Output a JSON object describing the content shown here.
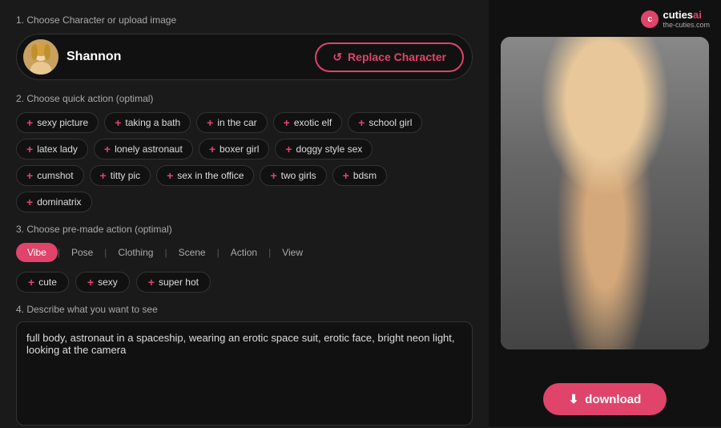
{
  "steps": {
    "step1": "1. Choose Character or upload image",
    "step2": "2. Choose quick action (optimal)",
    "step3": "3. Choose pre-made action (optimal)",
    "step4": "4. Describe what you want to see"
  },
  "character": {
    "name": "Shannon",
    "replace_label": "Replace Character"
  },
  "quick_actions": {
    "row1": [
      {
        "label": "sexy picture"
      },
      {
        "label": "taking a bath"
      },
      {
        "label": "in the car"
      },
      {
        "label": "exotic elf"
      },
      {
        "label": "school girl"
      }
    ],
    "row2": [
      {
        "label": "latex lady"
      },
      {
        "label": "lonely astronaut"
      },
      {
        "label": "boxer girl"
      },
      {
        "label": "doggy style sex"
      }
    ],
    "row3": [
      {
        "label": "cumshot"
      },
      {
        "label": "titty pic"
      },
      {
        "label": "sex in the office"
      },
      {
        "label": "two girls"
      },
      {
        "label": "bdsm"
      }
    ],
    "row4": [
      {
        "label": "dominatrix"
      }
    ]
  },
  "premade_tabs": [
    {
      "label": "Vibe",
      "active": true
    },
    {
      "label": "Pose",
      "active": false
    },
    {
      "label": "Clothing",
      "active": false
    },
    {
      "label": "Scene",
      "active": false
    },
    {
      "label": "Action",
      "active": false
    },
    {
      "label": "View",
      "active": false
    }
  ],
  "vibe_chips": [
    {
      "label": "cute"
    },
    {
      "label": "sexy"
    },
    {
      "label": "super hot"
    }
  ],
  "describe": {
    "placeholder": "Describe what you want to see",
    "value": "full body, astronaut in a spaceship, wearing an erotic space suit, erotic face, bright neon light, looking at the camera"
  },
  "brand": {
    "name": "cuties",
    "suffix": "ai",
    "sub": "the-cuties.com"
  },
  "download": {
    "label": "download"
  },
  "icons": {
    "replace": "↺",
    "plus": "+",
    "download": "⬇"
  }
}
